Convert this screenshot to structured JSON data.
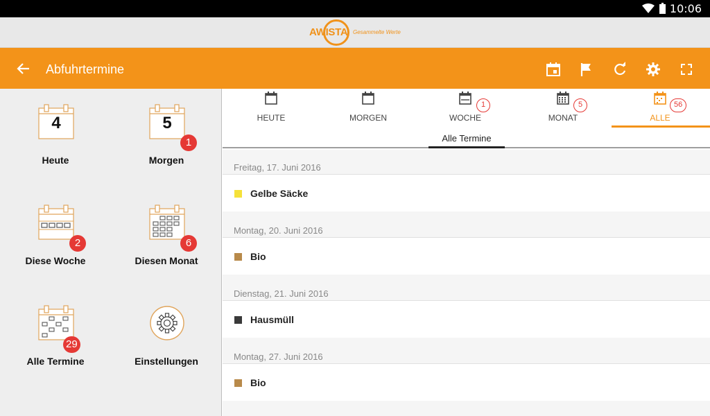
{
  "status_bar": {
    "time": "10:06",
    "icons": [
      "wifi-icon",
      "battery-icon"
    ]
  },
  "logo": {
    "word": "AWISTA",
    "slogan": "Gesammelte Werte"
  },
  "app_bar": {
    "title": "Abfuhrtermine",
    "actions": [
      "calendar-event-icon",
      "flag-icon",
      "refresh-icon",
      "settings-icon",
      "fullscreen-icon"
    ]
  },
  "sidebar": {
    "tiles": [
      {
        "label": "Heute",
        "number": "4",
        "badge": ""
      },
      {
        "label": "Morgen",
        "number": "5",
        "badge": "1"
      },
      {
        "label": "Diese Woche",
        "badge": "2"
      },
      {
        "label": "Diesen Monat",
        "badge": "6"
      },
      {
        "label": "Alle Termine",
        "badge": "29"
      },
      {
        "label": "Einstellungen",
        "badge": ""
      }
    ]
  },
  "tabs": [
    {
      "label": "HEUTE",
      "badge": ""
    },
    {
      "label": "MORGEN",
      "badge": ""
    },
    {
      "label": "WOCHE",
      "badge": "1"
    },
    {
      "label": "MONAT",
      "badge": "5"
    },
    {
      "label": "ALLE",
      "badge": "56",
      "active": true
    }
  ],
  "subheader": {
    "label": "Alle Termine"
  },
  "entries": [
    {
      "date": "Freitag, 17. Juni 2016",
      "name": "Gelbe Säcke",
      "color": "#f5e13a"
    },
    {
      "date": "Montag, 20. Juni 2016",
      "name": "Bio",
      "color": "#b88a4a"
    },
    {
      "date": "Dienstag, 21. Juni 2016",
      "name": "Hausmüll",
      "color": "#3a3a3a"
    },
    {
      "date": "Montag, 27. Juni 2016",
      "name": "Bio",
      "color": "#b88a4a"
    }
  ],
  "colors": {
    "accent": "#f39319",
    "badge": "#e53935",
    "calendar_line": "#e0a45a"
  }
}
